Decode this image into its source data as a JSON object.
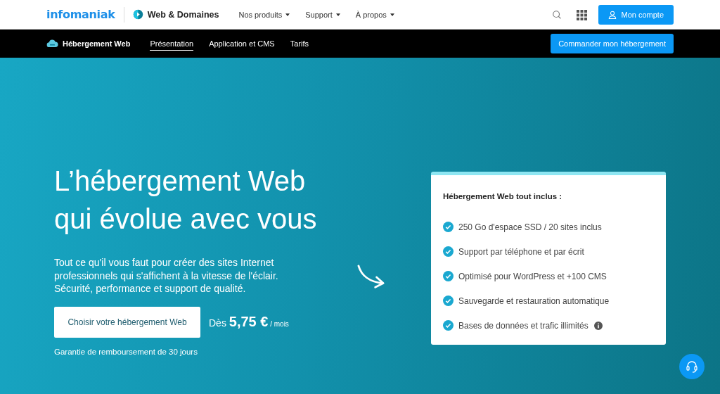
{
  "header": {
    "logo": "infomaniak",
    "product": "Web & Domaines",
    "nav": [
      "Nos produits",
      "Support",
      "À propos"
    ],
    "account_button": "Mon compte"
  },
  "subnav": {
    "title": "Hébergement Web",
    "tabs": [
      {
        "label": "Présentation",
        "selected": true
      },
      {
        "label": "Application et CMS",
        "selected": false
      },
      {
        "label": "Tarifs",
        "selected": false
      }
    ],
    "order_button": "Commander mon hébergement"
  },
  "hero": {
    "headline": [
      "L’hébergement Web",
      "qui évolue avec vous"
    ],
    "description": "Tout ce qu'il vous faut pour créer des sites Internet professionnels qui s'affichent à la vitesse de l'éclair. Sécurité, performance et support de qualité.",
    "cta_button": "Choisir votre hébergement Web",
    "price_prefix": "Dès",
    "price": "5,75 €",
    "price_suffix": "/ mois",
    "guarantee": "Garantie de remboursement de 30 jours"
  },
  "card": {
    "title": "Hébergement Web tout inclus :",
    "features": [
      {
        "text": "250 Go d'espace SSD / 20 sites inclus",
        "info": false
      },
      {
        "text": "Support par téléphone et par écrit",
        "info": false
      },
      {
        "text": "Optimisé pour WordPress et +100 CMS",
        "info": false
      },
      {
        "text": "Sauvegarde et restauration automatique",
        "info": false
      },
      {
        "text": "Bases de données et trafic illimités",
        "info": true
      }
    ]
  }
}
